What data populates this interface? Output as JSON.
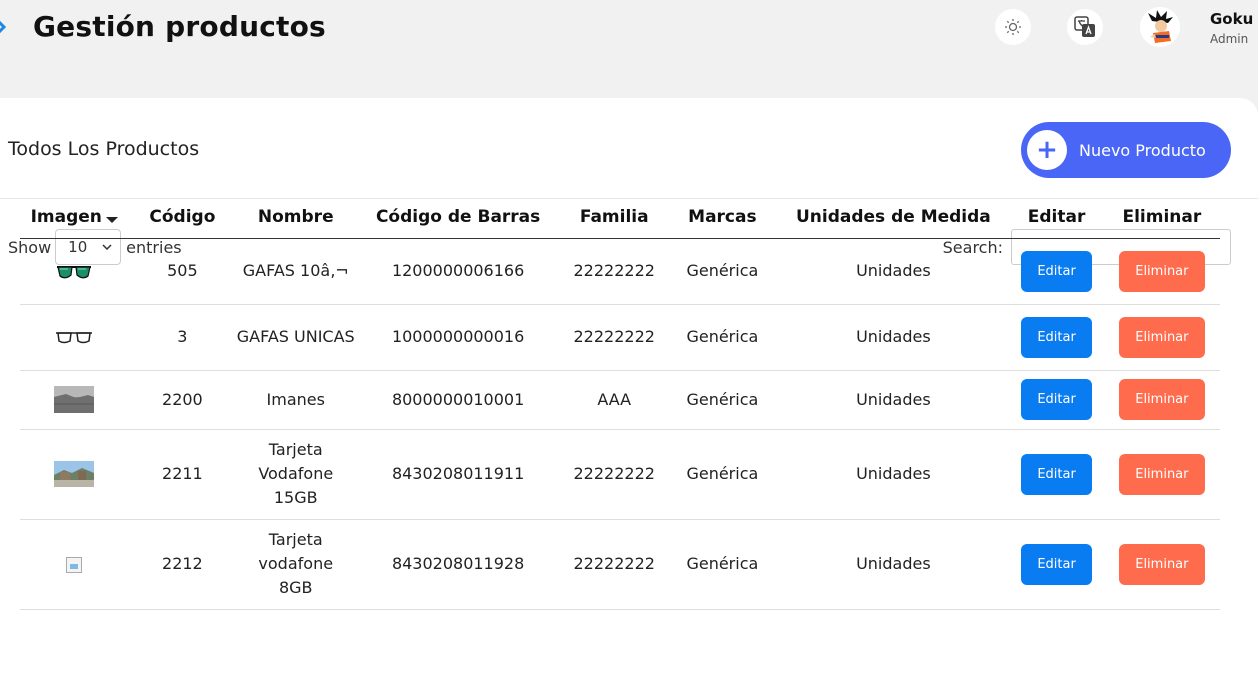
{
  "header": {
    "title": "Gestión productos",
    "user": {
      "name": "Goku",
      "role": "Admin"
    }
  },
  "card": {
    "title": "Todos Los Productos",
    "new_button": "Nuevo Producto"
  },
  "controls": {
    "show_label": "Show",
    "entries_value": "10",
    "entries_label": "entries",
    "search_label": "Search:",
    "search_value": ""
  },
  "table": {
    "columns": [
      "Imagen",
      "Código",
      "Nombre",
      "Código de Barras",
      "Familia",
      "Marcas",
      "Unidades de Medida",
      "Editar",
      "Eliminar"
    ],
    "rows": [
      {
        "image": "sunglasses",
        "codigo": "505",
        "nombre": "GAFAS 10â‚¬",
        "barras": "1200000006166",
        "familia": "22222222",
        "marca": "Genérica",
        "unidad": "Unidades",
        "editar": "Editar",
        "eliminar": "Eliminar"
      },
      {
        "image": "glasses",
        "codigo": "3",
        "nombre": "GAFAS UNICAS",
        "barras": "1000000000016",
        "familia": "22222222",
        "marca": "Genérica",
        "unidad": "Unidades",
        "editar": "Editar",
        "eliminar": "Eliminar"
      },
      {
        "image": "magnet-photo",
        "codigo": "2200",
        "nombre": "Imanes",
        "barras": "8000000010001",
        "familia": "AAA",
        "marca": "Genérica",
        "unidad": "Unidades",
        "editar": "Editar",
        "eliminar": "Eliminar"
      },
      {
        "image": "landscape-photo",
        "codigo": "2211",
        "nombre": "Tarjeta Vodafone 15GB",
        "barras": "8430208011911",
        "familia": "22222222",
        "marca": "Genérica",
        "unidad": "Unidades",
        "editar": "Editar",
        "eliminar": "Eliminar"
      },
      {
        "image": "broken-image",
        "codigo": "2212",
        "nombre": "Tarjeta vodafone 8GB",
        "barras": "8430208011928",
        "familia": "22222222",
        "marca": "Genérica",
        "unidad": "Unidades",
        "editar": "Editar",
        "eliminar": "Eliminar"
      }
    ]
  }
}
